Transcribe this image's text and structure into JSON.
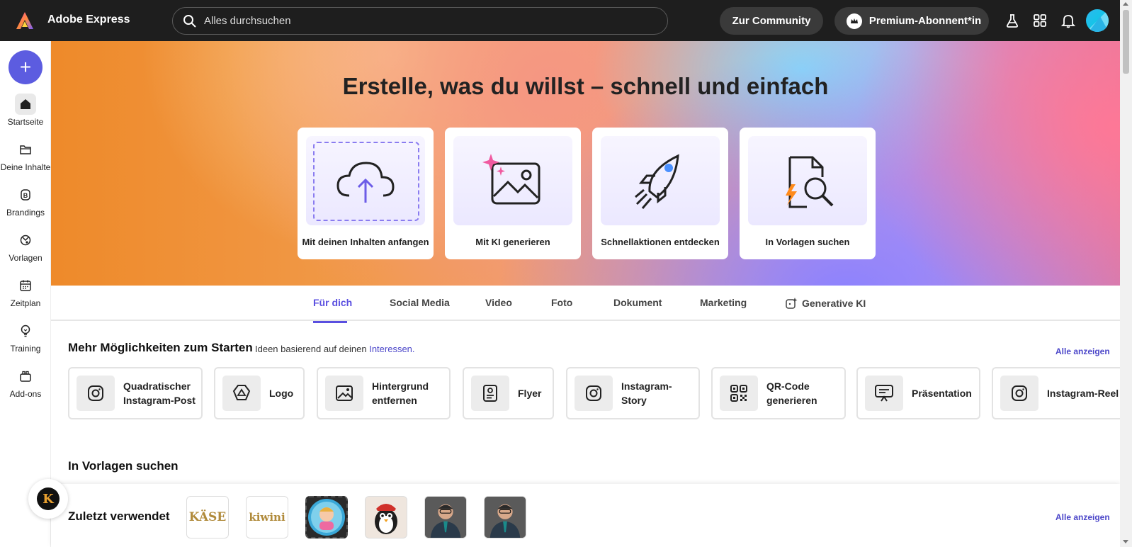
{
  "topbar": {
    "app_title": "Adobe Express",
    "search_placeholder": "Alles durchsuchen",
    "community_label": "Zur Community",
    "premium_label": "Premium-Abonnent*in"
  },
  "sidebar": {
    "create_label": "+",
    "items": [
      {
        "label": "Startseite",
        "icon": "home-icon"
      },
      {
        "label": "Deine Inhalte",
        "icon": "folder-icon"
      },
      {
        "label": "Brandings",
        "icon": "brand-icon"
      },
      {
        "label": "Vorlagen",
        "icon": "templates-icon"
      },
      {
        "label": "Zeitplan",
        "icon": "calendar-icon"
      },
      {
        "label": "Training",
        "icon": "lightbulb-icon"
      },
      {
        "label": "Add-ons",
        "icon": "addons-icon"
      }
    ]
  },
  "hero": {
    "title": "Erstelle, was du willst – schnell und einfach",
    "cards": [
      {
        "label": "Mit deinen Inhalten anfangen",
        "icon": "cloud-upload-icon"
      },
      {
        "label": "Mit KI generieren",
        "icon": "ai-image-icon"
      },
      {
        "label": "Schnellaktionen entdecken",
        "icon": "rocket-icon"
      },
      {
        "label": "In Vorlagen suchen",
        "icon": "template-search-icon"
      }
    ]
  },
  "tabs": [
    "Für dich",
    "Social Media",
    "Video",
    "Foto",
    "Dokument",
    "Marketing",
    "Generative KI"
  ],
  "quick": {
    "title": "Mehr Möglichkeiten zum Starten",
    "subtitle_prefix": "Ideen basierend auf deinen",
    "subtitle_link": "Interessen.",
    "show_all": "Alle anzeigen",
    "items": [
      {
        "label": "Quadratischer Instagram-Post",
        "icon": "instagram-icon"
      },
      {
        "label": "Logo",
        "icon": "logo-icon"
      },
      {
        "label": "Hintergrund entfernen",
        "icon": "remove-background-icon"
      },
      {
        "label": "Flyer",
        "icon": "flyer-icon"
      },
      {
        "label": "Instagram-Story",
        "icon": "instagram-icon"
      },
      {
        "label": "QR-Code generieren",
        "icon": "qr-code-icon"
      },
      {
        "label": "Präsentation",
        "icon": "presentation-icon"
      },
      {
        "label": "Instagram-Reel",
        "icon": "instagram-icon"
      }
    ]
  },
  "templates": {
    "title": "In Vorlagen suchen"
  },
  "recent": {
    "title": "Zuletzt verwendet",
    "show_all": "Alle anzeigen",
    "thumbs": [
      "KÄSE",
      "kiwini"
    ]
  },
  "badge_letter": "K",
  "colors": {
    "accent": "#5a4fe0",
    "topbar": "#1e1e1e",
    "plus": "#5c5ce0"
  }
}
